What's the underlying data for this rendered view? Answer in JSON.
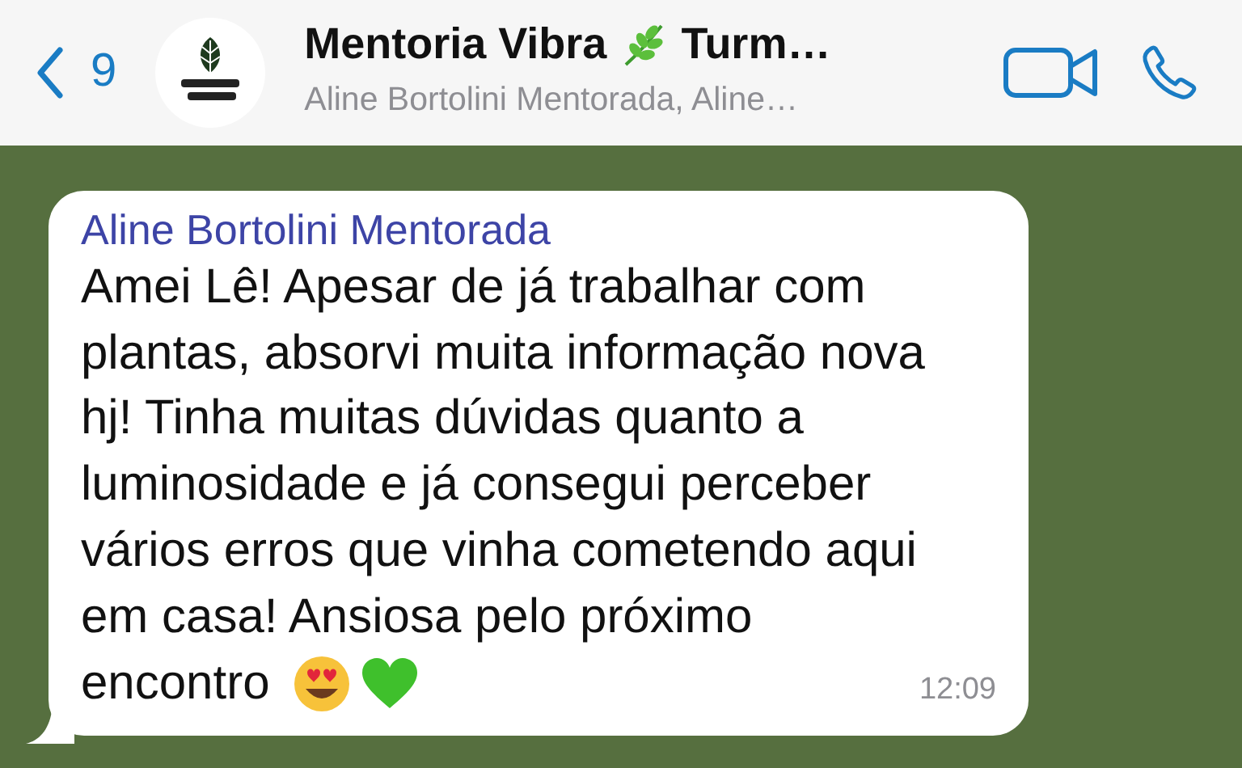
{
  "header": {
    "back_count": "9",
    "title": [
      "Mentoria Vibra",
      "Turm…"
    ],
    "subtitle": "Aline Bortolini Mentorada, Aline…"
  },
  "message": {
    "sender": "Aline Bortolini Mentorada",
    "text": "Amei Lê! Apesar de já trabalhar com\nplantas, absorvi muita informação nova\nhj! Tinha muitas dúvidas quanto a\nluminosidade e já consegui perceber\nvários erros que vinha cometendo aqui\nem casa! Ansiosa pelo próximo\nencontro",
    "time": "12:09"
  }
}
